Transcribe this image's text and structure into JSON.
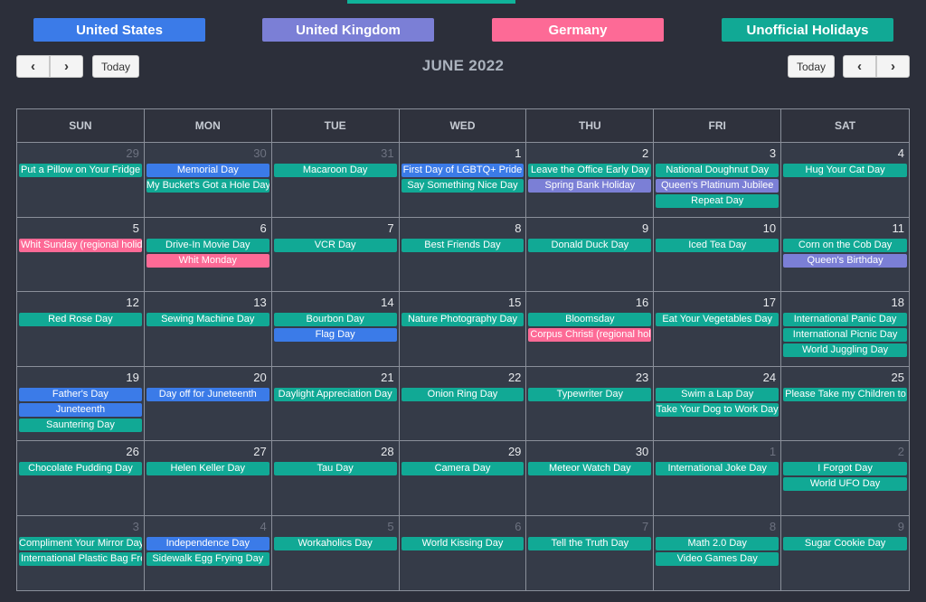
{
  "colors": {
    "us": "#3b7be8",
    "uk": "#7b7fd6",
    "de": "#fd6a96",
    "unofficial": "#11a995"
  },
  "legend": [
    {
      "label": "United States",
      "type": "us"
    },
    {
      "label": "United Kingdom",
      "type": "uk"
    },
    {
      "label": "Germany",
      "type": "de"
    },
    {
      "label": "Unofficial Holidays",
      "type": "unofficial"
    }
  ],
  "toolbar": {
    "today_label": "Today",
    "prev_icon": "‹",
    "next_icon": "›",
    "title": "JUNE 2022"
  },
  "weekdays": [
    "SUN",
    "MON",
    "TUE",
    "WED",
    "THU",
    "FRI",
    "SAT"
  ],
  "weeks": [
    [
      {
        "day": "29",
        "other": true,
        "events": [
          {
            "t": "Put a Pillow on Your Fridge Day",
            "c": "unofficial"
          }
        ]
      },
      {
        "day": "30",
        "other": true,
        "events": [
          {
            "t": "Memorial Day",
            "c": "us"
          },
          {
            "t": "My Bucket's Got a Hole Day",
            "c": "unofficial"
          }
        ]
      },
      {
        "day": "31",
        "other": true,
        "events": [
          {
            "t": "Macaroon Day",
            "c": "unofficial"
          }
        ]
      },
      {
        "day": "1",
        "events": [
          {
            "t": "First Day of LGBTQ+ Pride Month",
            "c": "us"
          },
          {
            "t": "Say Something Nice Day",
            "c": "unofficial"
          }
        ]
      },
      {
        "day": "2",
        "events": [
          {
            "t": "Leave the Office Early Day",
            "c": "unofficial"
          },
          {
            "t": "Spring Bank Holiday",
            "c": "uk"
          }
        ]
      },
      {
        "day": "3",
        "events": [
          {
            "t": "National Doughnut Day",
            "c": "unofficial"
          },
          {
            "t": "Queen's Platinum Jubilee",
            "c": "uk"
          },
          {
            "t": "Repeat Day",
            "c": "unofficial"
          }
        ]
      },
      {
        "day": "4",
        "events": [
          {
            "t": "Hug Your Cat Day",
            "c": "unofficial"
          }
        ]
      }
    ],
    [
      {
        "day": "5",
        "events": [
          {
            "t": "Whit Sunday (regional holiday)",
            "c": "de"
          }
        ]
      },
      {
        "day": "6",
        "events": [
          {
            "t": "Drive-In Movie Day",
            "c": "unofficial"
          },
          {
            "t": "Whit Monday",
            "c": "de"
          }
        ]
      },
      {
        "day": "7",
        "events": [
          {
            "t": "VCR Day",
            "c": "unofficial"
          }
        ]
      },
      {
        "day": "8",
        "events": [
          {
            "t": "Best Friends Day",
            "c": "unofficial"
          }
        ]
      },
      {
        "day": "9",
        "events": [
          {
            "t": "Donald Duck Day",
            "c": "unofficial"
          }
        ]
      },
      {
        "day": "10",
        "events": [
          {
            "t": "Iced Tea Day",
            "c": "unofficial"
          }
        ]
      },
      {
        "day": "11",
        "events": [
          {
            "t": "Corn on the Cob Day",
            "c": "unofficial"
          },
          {
            "t": "Queen's Birthday",
            "c": "uk"
          }
        ]
      }
    ],
    [
      {
        "day": "12",
        "events": [
          {
            "t": "Red Rose Day",
            "c": "unofficial"
          }
        ]
      },
      {
        "day": "13",
        "events": [
          {
            "t": "Sewing Machine Day",
            "c": "unofficial"
          }
        ]
      },
      {
        "day": "14",
        "events": [
          {
            "t": "Bourbon Day",
            "c": "unofficial"
          },
          {
            "t": "Flag Day",
            "c": "us"
          }
        ]
      },
      {
        "day": "15",
        "events": [
          {
            "t": "Nature Photography Day",
            "c": "unofficial"
          }
        ]
      },
      {
        "day": "16",
        "events": [
          {
            "t": "Bloomsday",
            "c": "unofficial"
          },
          {
            "t": "Corpus Christi (regional holiday)",
            "c": "de"
          }
        ]
      },
      {
        "day": "17",
        "events": [
          {
            "t": "Eat Your Vegetables Day",
            "c": "unofficial"
          }
        ]
      },
      {
        "day": "18",
        "events": [
          {
            "t": "International Panic Day",
            "c": "unofficial"
          },
          {
            "t": "International Picnic Day",
            "c": "unofficial"
          },
          {
            "t": "World Juggling Day",
            "c": "unofficial"
          }
        ]
      }
    ],
    [
      {
        "day": "19",
        "events": [
          {
            "t": "Father's Day",
            "c": "us"
          },
          {
            "t": "Juneteenth",
            "c": "us"
          },
          {
            "t": "Sauntering Day",
            "c": "unofficial"
          }
        ]
      },
      {
        "day": "20",
        "events": [
          {
            "t": "Day off for Juneteenth",
            "c": "us"
          }
        ]
      },
      {
        "day": "21",
        "events": [
          {
            "t": "Daylight Appreciation Day",
            "c": "unofficial"
          }
        ]
      },
      {
        "day": "22",
        "events": [
          {
            "t": "Onion Ring Day",
            "c": "unofficial"
          }
        ]
      },
      {
        "day": "23",
        "events": [
          {
            "t": "Typewriter Day",
            "c": "unofficial"
          }
        ]
      },
      {
        "day": "24",
        "events": [
          {
            "t": "Swim a Lap Day",
            "c": "unofficial"
          },
          {
            "t": "Take Your Dog to Work Day",
            "c": "unofficial"
          }
        ]
      },
      {
        "day": "25",
        "events": [
          {
            "t": "Please Take my Children to Work Day",
            "c": "unofficial"
          }
        ]
      }
    ],
    [
      {
        "day": "26",
        "events": [
          {
            "t": "Chocolate Pudding Day",
            "c": "unofficial"
          }
        ]
      },
      {
        "day": "27",
        "events": [
          {
            "t": "Helen Keller Day",
            "c": "unofficial"
          }
        ]
      },
      {
        "day": "28",
        "events": [
          {
            "t": "Tau Day",
            "c": "unofficial"
          }
        ]
      },
      {
        "day": "29",
        "events": [
          {
            "t": "Camera Day",
            "c": "unofficial"
          }
        ]
      },
      {
        "day": "30",
        "events": [
          {
            "t": "Meteor Watch Day",
            "c": "unofficial"
          }
        ]
      },
      {
        "day": "1",
        "other": true,
        "events": [
          {
            "t": "International Joke Day",
            "c": "unofficial"
          }
        ]
      },
      {
        "day": "2",
        "other": true,
        "events": [
          {
            "t": "I Forgot Day",
            "c": "unofficial"
          },
          {
            "t": "World UFO Day",
            "c": "unofficial"
          }
        ]
      }
    ],
    [
      {
        "day": "3",
        "other": true,
        "events": [
          {
            "t": "Compliment Your Mirror Day",
            "c": "unofficial"
          },
          {
            "t": "International Plastic Bag Free Day",
            "c": "unofficial"
          }
        ]
      },
      {
        "day": "4",
        "other": true,
        "events": [
          {
            "t": "Independence Day",
            "c": "us"
          },
          {
            "t": "Sidewalk Egg Frying Day",
            "c": "unofficial"
          }
        ]
      },
      {
        "day": "5",
        "other": true,
        "events": [
          {
            "t": "Workaholics Day",
            "c": "unofficial"
          }
        ]
      },
      {
        "day": "6",
        "other": true,
        "events": [
          {
            "t": "World Kissing Day",
            "c": "unofficial"
          }
        ]
      },
      {
        "day": "7",
        "other": true,
        "events": [
          {
            "t": "Tell the Truth Day",
            "c": "unofficial"
          }
        ]
      },
      {
        "day": "8",
        "other": true,
        "events": [
          {
            "t": "Math 2.0 Day",
            "c": "unofficial"
          },
          {
            "t": "Video Games Day",
            "c": "unofficial"
          }
        ]
      },
      {
        "day": "9",
        "other": true,
        "events": [
          {
            "t": "Sugar Cookie Day",
            "c": "unofficial"
          }
        ]
      }
    ]
  ]
}
